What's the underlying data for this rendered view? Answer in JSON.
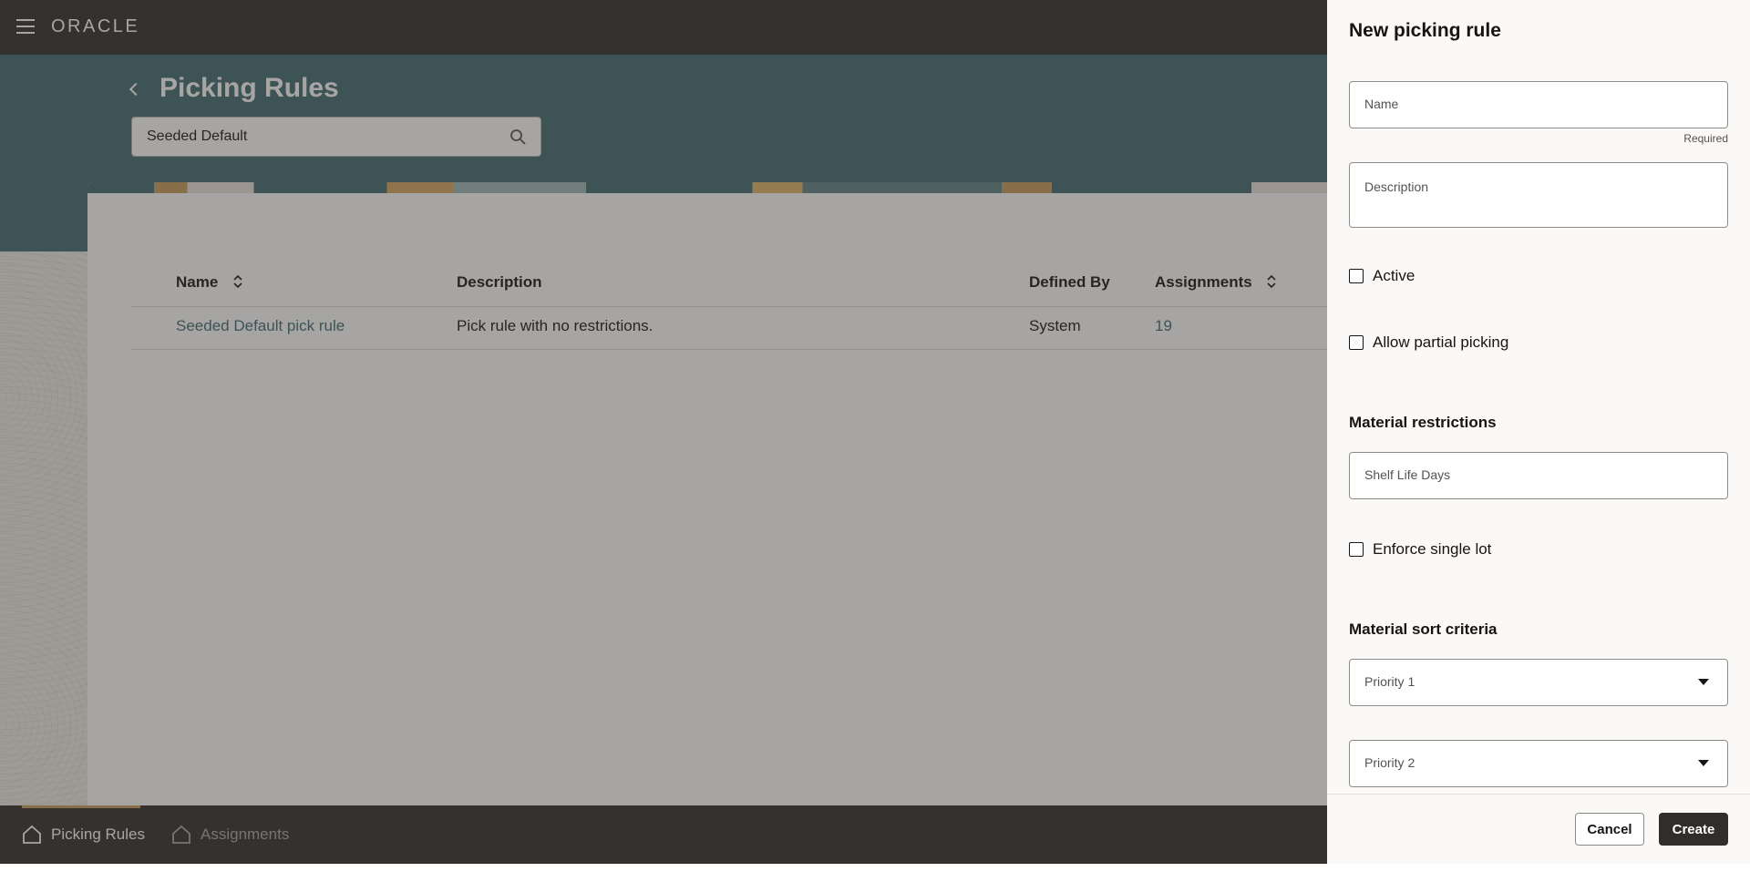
{
  "header": {
    "logo": "ORACLE"
  },
  "page": {
    "title": "Picking Rules",
    "search": {
      "value": "Seeded Default"
    }
  },
  "table": {
    "columns": [
      "Name",
      "Description",
      "Defined By",
      "Assignments"
    ],
    "rows": [
      {
        "name": "Seeded Default pick rule",
        "description": "Pick rule with no restrictions.",
        "defined_by": "System",
        "assignments": "19"
      }
    ]
  },
  "bottom_nav": {
    "tabs": [
      {
        "label": "Picking Rules",
        "active": true
      },
      {
        "label": "Assignments",
        "active": false
      }
    ]
  },
  "drawer": {
    "title": "New picking rule",
    "name_label": "Name",
    "required_text": "Required",
    "description_label": "Description",
    "active_label": "Active",
    "partial_label": "Allow partial picking",
    "material_restrictions_title": "Material restrictions",
    "shelf_life_label": "Shelf Life Days",
    "single_lot_label": "Enforce single lot",
    "sort_criteria_title": "Material sort criteria",
    "priority1_label": "Priority 1",
    "priority2_label": "Priority 2",
    "cancel_label": "Cancel",
    "create_label": "Create"
  },
  "colors": {
    "brand_dark": "#312d2a",
    "hero_teal": "#3f6b72",
    "link": "#3d6a72",
    "accent_gold": "#c79d5b"
  }
}
